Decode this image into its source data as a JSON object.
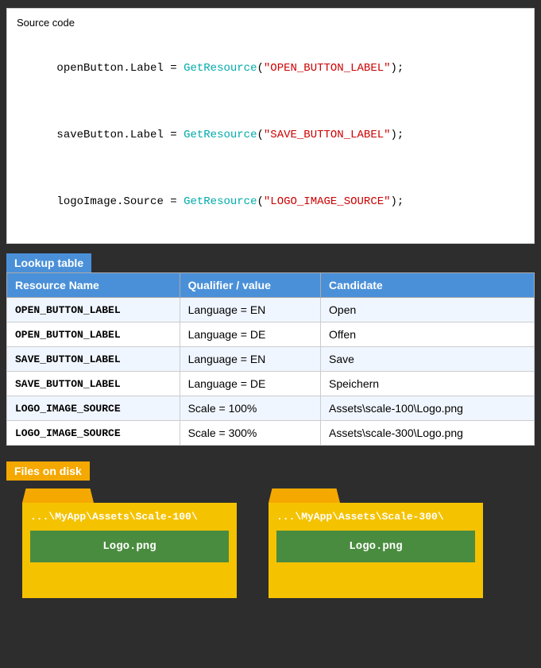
{
  "source_code": {
    "section_label": "Source code",
    "lines": [
      {
        "prefix": "openButton.Label = ",
        "function": "GetResource",
        "arg": "\"OPEN_BUTTON_LABEL\"",
        "suffix": ");"
      },
      {
        "prefix": "saveButton.Label = ",
        "function": "GetResource",
        "arg": "\"SAVE_BUTTON_LABEL\"",
        "suffix": ");"
      },
      {
        "prefix": "logoImage.Source = ",
        "function": "GetResource",
        "arg": "\"LOGO_IMAGE_SOURCE\"",
        "suffix": ");"
      }
    ]
  },
  "lookup_table": {
    "section_label": "Lookup table",
    "columns": [
      "Resource Name",
      "Qualifier / value",
      "Candidate"
    ],
    "rows": [
      {
        "resource_name": "OPEN_BUTTON_LABEL",
        "qualifier": "Language = EN",
        "candidate": "Open"
      },
      {
        "resource_name": "OPEN_BUTTON_LABEL",
        "qualifier": "Language = DE",
        "candidate": "Offen"
      },
      {
        "resource_name": "SAVE_BUTTON_LABEL",
        "qualifier": "Language = EN",
        "candidate": "Save"
      },
      {
        "resource_name": "SAVE_BUTTON_LABEL",
        "qualifier": "Language = DE",
        "candidate": "Speichern"
      },
      {
        "resource_name": "LOGO_IMAGE_SOURCE",
        "qualifier": "Scale = 100%",
        "candidate": "Assets\\scale-100\\Logo.png"
      },
      {
        "resource_name": "LOGO_IMAGE_SOURCE",
        "qualifier": "Scale = 300%",
        "candidate": "Assets\\scale-300\\Logo.png"
      }
    ]
  },
  "files_on_disk": {
    "section_label": "Files on disk",
    "folders": [
      {
        "path": "...\\MyApp\\Assets\\Scale-100\\",
        "file": "Logo.png"
      },
      {
        "path": "...\\MyApp\\Assets\\Scale-300\\",
        "file": "Logo.png"
      }
    ]
  }
}
